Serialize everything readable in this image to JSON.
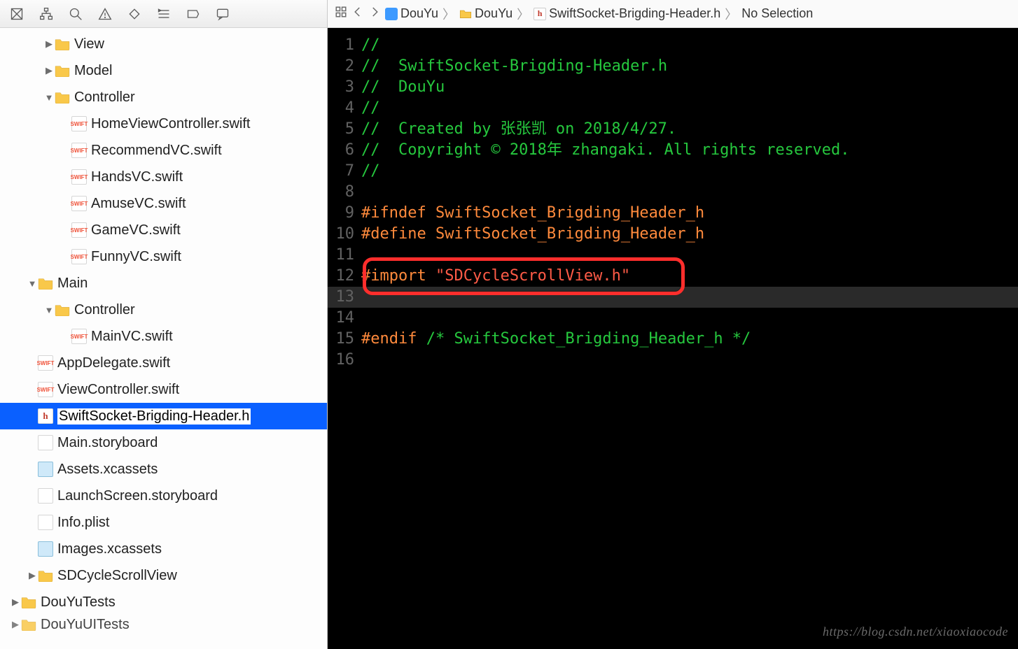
{
  "toolbar_icons": [
    "navigator",
    "hierarchy",
    "search",
    "warning",
    "debug",
    "breakpoint",
    "report",
    "tags",
    "chat"
  ],
  "tree": [
    {
      "label": "View",
      "type": "folder",
      "depth": 2,
      "expanded": false,
      "disclosure": "▶"
    },
    {
      "label": "Model",
      "type": "folder",
      "depth": 2,
      "expanded": false,
      "disclosure": "▶"
    },
    {
      "label": "Controller",
      "type": "folder",
      "depth": 2,
      "expanded": true,
      "disclosure": "▼"
    },
    {
      "label": "HomeViewController.swift",
      "type": "swift",
      "depth": 3
    },
    {
      "label": "RecommendVC.swift",
      "type": "swift",
      "depth": 3
    },
    {
      "label": "HandsVC.swift",
      "type": "swift",
      "depth": 3
    },
    {
      "label": "AmuseVC.swift",
      "type": "swift",
      "depth": 3
    },
    {
      "label": "GameVC.swift",
      "type": "swift",
      "depth": 3
    },
    {
      "label": "FunnyVC.swift",
      "type": "swift",
      "depth": 3
    },
    {
      "label": "Main",
      "type": "folder",
      "depth": 1,
      "expanded": true,
      "disclosure": "▼"
    },
    {
      "label": "Controller",
      "type": "folder",
      "depth": 2,
      "expanded": true,
      "disclosure": "▼"
    },
    {
      "label": "MainVC.swift",
      "type": "swift",
      "depth": 3
    },
    {
      "label": "AppDelegate.swift",
      "type": "swift",
      "depth": 1,
      "noarrow": true
    },
    {
      "label": "ViewController.swift",
      "type": "swift",
      "depth": 1,
      "noarrow": true
    },
    {
      "label": "SwiftSocket-Brigding-Header.h",
      "type": "h",
      "depth": 1,
      "noarrow": true,
      "selected": true
    },
    {
      "label": "Main.storyboard",
      "type": "sb",
      "depth": 1,
      "noarrow": true
    },
    {
      "label": "Assets.xcassets",
      "type": "xc",
      "depth": 1,
      "noarrow": true
    },
    {
      "label": "LaunchScreen.storyboard",
      "type": "sb",
      "depth": 1,
      "noarrow": true
    },
    {
      "label": "Info.plist",
      "type": "plist",
      "depth": 1,
      "noarrow": true
    },
    {
      "label": "Images.xcassets",
      "type": "xc",
      "depth": 1,
      "noarrow": true
    },
    {
      "label": "SDCycleScrollView",
      "type": "folder",
      "depth": 1,
      "expanded": false,
      "disclosure": "▶"
    },
    {
      "label": "DouYuTests",
      "type": "folder",
      "depth": 0,
      "expanded": false,
      "disclosure": "▶"
    },
    {
      "label": "DouYuUITests",
      "type": "folder",
      "depth": 0,
      "expanded": false,
      "disclosure": "▶",
      "partial": true
    }
  ],
  "breadcrumb": {
    "project": "DouYu",
    "group": "DouYu",
    "file": "SwiftSocket-Brigding-Header.h",
    "selection": "No Selection"
  },
  "code": [
    {
      "n": 1,
      "kind": "comment",
      "text": "//"
    },
    {
      "n": 2,
      "kind": "comment",
      "text": "//  SwiftSocket-Brigding-Header.h"
    },
    {
      "n": 3,
      "kind": "comment",
      "text": "//  DouYu"
    },
    {
      "n": 4,
      "kind": "comment",
      "text": "//"
    },
    {
      "n": 5,
      "kind": "comment",
      "text": "//  Created by 张张凯 on 2018/4/27."
    },
    {
      "n": 6,
      "kind": "comment",
      "text": "//  Copyright © 2018年 zhangaki. All rights reserved."
    },
    {
      "n": 7,
      "kind": "comment",
      "text": "//"
    },
    {
      "n": 8,
      "kind": "blank",
      "text": ""
    },
    {
      "n": 9,
      "kind": "dir",
      "text": "#ifndef SwiftSocket_Brigding_Header_h"
    },
    {
      "n": 10,
      "kind": "dir",
      "text": "#define SwiftSocket_Brigding_Header_h"
    },
    {
      "n": 11,
      "kind": "blank",
      "text": ""
    },
    {
      "n": 12,
      "kind": "import",
      "dir": "#import ",
      "str": "\"SDCycleScrollView.h\""
    },
    {
      "n": 13,
      "kind": "blank",
      "text": "",
      "current": true
    },
    {
      "n": 14,
      "kind": "blank",
      "text": ""
    },
    {
      "n": 15,
      "kind": "endif",
      "dir": "#endif ",
      "cmt": "/* SwiftSocket_Brigding_Header_h */"
    },
    {
      "n": 16,
      "kind": "blank",
      "text": ""
    }
  ],
  "watermark": "https://blog.csdn.net/xiaoxiaocode"
}
